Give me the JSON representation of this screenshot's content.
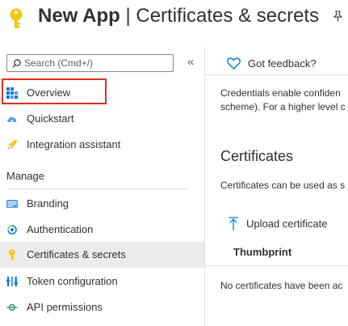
{
  "header": {
    "app_name": "New App",
    "separator": "|",
    "page_name": "Certificates & secrets"
  },
  "search": {
    "placeholder": "Search (Cmd+/)"
  },
  "sidebar": {
    "collapse_label": "«",
    "items": [
      {
        "label": "Overview",
        "icon": "overview-grid-icon"
      },
      {
        "label": "Quickstart",
        "icon": "quickstart-cloud-icon"
      },
      {
        "label": "Integration assistant",
        "icon": "rocket-icon"
      }
    ],
    "manage_label": "Manage",
    "manage_items": [
      {
        "label": "Branding",
        "icon": "branding-icon"
      },
      {
        "label": "Authentication",
        "icon": "authentication-icon"
      },
      {
        "label": "Certificates & secrets",
        "icon": "key-icon",
        "active": true
      },
      {
        "label": "Token configuration",
        "icon": "token-bars-icon"
      },
      {
        "label": "API permissions",
        "icon": "api-permissions-icon"
      }
    ]
  },
  "main": {
    "feedback_label": "Got feedback?",
    "credentials_line1": "Credentials enable confiden",
    "credentials_line2": "scheme). For a higher level c",
    "certificates_heading": "Certificates",
    "certificates_desc": "Certificates can be used as s",
    "upload_label": "Upload certificate",
    "thumbprint_header": "Thumbprint",
    "no_certs_text": "No certificates have been ac"
  },
  "colors": {
    "accent": "#0078d4",
    "key_yellow": "#f2c811",
    "highlight_box": "#e0301e",
    "active_bg": "#ebebeb"
  }
}
